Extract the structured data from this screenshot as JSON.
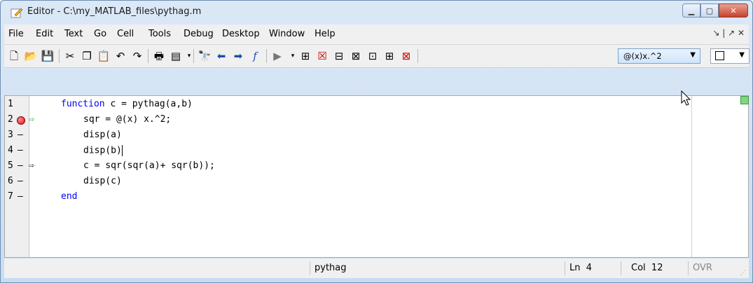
{
  "window": {
    "title": "Editor - C:\\my_MATLAB_files\\pythag.m"
  },
  "menu": [
    "File",
    "Edit",
    "Text",
    "Go",
    "Cell",
    "Tools",
    "Debug",
    "Desktop",
    "Window",
    "Help"
  ],
  "menu_right": "↘ | ↗ ✕",
  "toolbar": {
    "function_combo": "@(x)x.^2"
  },
  "editor": {
    "lines": [
      {
        "num": "1",
        "marker": "",
        "arrow": "",
        "indent": "",
        "keyword": "function",
        "rest": " c = pythag(a,b)"
      },
      {
        "num": "2",
        "marker": "breakpoint",
        "arrow": "⇨",
        "indent": "    ",
        "keyword": "",
        "rest": "sqr = @(x) x.^2;"
      },
      {
        "num": "3",
        "marker": "dash",
        "arrow": "",
        "indent": "    ",
        "keyword": "",
        "rest": "disp(a)"
      },
      {
        "num": "4",
        "marker": "dash",
        "arrow": "",
        "indent": "    ",
        "keyword": "",
        "rest": "disp(b)"
      },
      {
        "num": "5",
        "marker": "dash",
        "arrow": "⇨",
        "indent": "    ",
        "keyword": "",
        "rest": "c = sqr(sqr(a)+ sqr(b));"
      },
      {
        "num": "6",
        "marker": "dash",
        "arrow": "",
        "indent": "    ",
        "keyword": "",
        "rest": "disp(c)"
      },
      {
        "num": "7",
        "marker": "dash",
        "arrow": "",
        "indent": "",
        "keyword": "end",
        "rest": ""
      }
    ]
  },
  "status": {
    "function_name": "pythag",
    "ln_label": "Ln",
    "ln_value": "4",
    "col_label": "Col",
    "col_value": "12",
    "mode": "OVR"
  },
  "colors": {
    "keyword": "#0000ff",
    "breakpoint": "#d11b1b",
    "exec_arrow": "#2aa02a"
  }
}
